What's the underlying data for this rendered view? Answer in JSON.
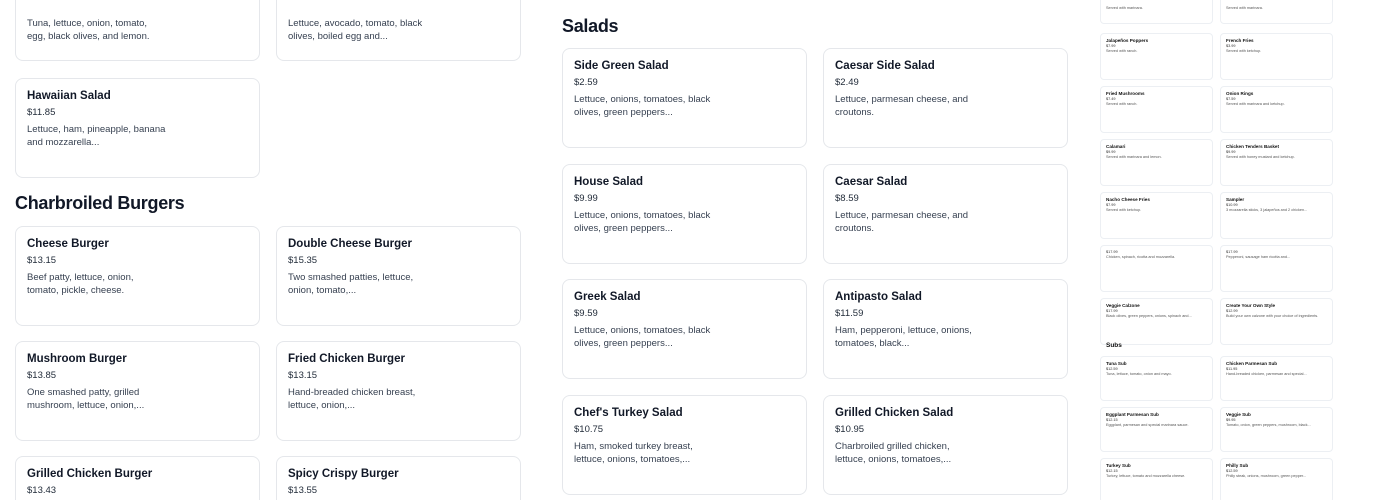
{
  "left_top_cards": [
    {
      "desc": "Tuna, lettuce, onion, tomato, egg, black olives, and lemon."
    },
    {
      "desc": "Lettuce, avocado, tomato, black olives, boiled egg and..."
    }
  ],
  "hawaiian": {
    "name": "Hawaiian Salad",
    "price": "$11.85",
    "desc": "Lettuce, ham, pineapple, banana and mozzarella..."
  },
  "burgers": {
    "title": "Charbroiled Burgers",
    "items": [
      {
        "name": "Cheese Burger",
        "price": "$13.15",
        "desc": "Beef patty, lettuce, onion, tomato, pickle, cheese."
      },
      {
        "name": "Double Cheese Burger",
        "price": "$15.35",
        "desc": "Two smashed patties, lettuce, onion, tomato,..."
      },
      {
        "name": "Mushroom Burger",
        "price": "$13.85",
        "desc": "One smashed patty, grilled mushroom, lettuce, onion,..."
      },
      {
        "name": "Fried Chicken Burger",
        "price": "$13.15",
        "desc": "Hand-breaded chicken breast, lettuce, onion,..."
      },
      {
        "name": "Grilled Chicken Burger",
        "price": "$13.43",
        "desc": ""
      },
      {
        "name": "Spicy Crispy Burger",
        "price": "$13.55",
        "desc": ""
      }
    ]
  },
  "salads": {
    "title": "Salads",
    "items": [
      {
        "name": "Side Green Salad",
        "price": "$2.59",
        "desc": "Lettuce, onions, tomatoes, black olives, green peppers..."
      },
      {
        "name": "Caesar Side Salad",
        "price": "$2.49",
        "desc": "Lettuce, parmesan cheese, and croutons."
      },
      {
        "name": "House Salad",
        "price": "$9.99",
        "desc": "Lettuce, onions, tomatoes, black olives, green peppers..."
      },
      {
        "name": "Caesar Salad",
        "price": "$8.59",
        "desc": "Lettuce, parmesan cheese, and croutons."
      },
      {
        "name": "Greek Salad",
        "price": "$9.59",
        "desc": "Lettuce, onions, tomatoes, black olives, green peppers..."
      },
      {
        "name": "Antipasto Salad",
        "price": "$11.59",
        "desc": "Ham, pepperoni, lettuce, onions, tomatoes, black..."
      },
      {
        "name": "Chef's Turkey Salad",
        "price": "$10.75",
        "desc": "Ham, smoked turkey breast, lettuce, onions, tomatoes,..."
      },
      {
        "name": "Grilled Chicken Salad",
        "price": "$10.95",
        "desc": "Charbroiled grilled chicken, lettuce, onions, tomatoes,..."
      }
    ]
  },
  "mini": {
    "row0": [
      {
        "desc": "Served with marinara."
      },
      {
        "desc": "Served with marinara."
      }
    ],
    "items": [
      {
        "name": "Jalapeños Poppers",
        "price": "$7.99",
        "desc": "Served with ranch."
      },
      {
        "name": "French Fries",
        "price": "$3.99",
        "desc": "Served with ketchup."
      },
      {
        "name": "Fried Mushrooms",
        "price": "$7.49",
        "desc": "Served with ranch."
      },
      {
        "name": "Onion Rings",
        "price": "$7.59",
        "desc": "Served with marinara and ketchup."
      },
      {
        "name": "Calamari",
        "price": "$9.99",
        "desc": "Served with marinara and lemon."
      },
      {
        "name": "Chicken Tenders Basket",
        "price": "$9.99",
        "desc": "Served with honey mustard and ketchup."
      },
      {
        "name": "Nacho Cheese Fries",
        "price": "$7.99",
        "desc": "Served with ketchup."
      },
      {
        "name": "Sampler",
        "price": "$10.99",
        "desc": "3 mozzarella sticks, 3 jalapeños and 2 chicken..."
      },
      {
        "name": "",
        "price": "$17.99",
        "desc": "Chicken, spinach, ricotta and mozzarella."
      },
      {
        "name": "",
        "price": "$17.99",
        "desc": "Pepperoni, sausage ham ricotta and..."
      },
      {
        "name": "Veggie Calzone",
        "price": "$17.99",
        "desc": "Black olives, green peppers, onions, spinach and..."
      },
      {
        "name": "Create Your Own Style",
        "price": "$12.99",
        "desc": "Build your own calzone with your choice of ingredients."
      }
    ],
    "subs_title": "Subs",
    "subs": [
      {
        "name": "Tuna Sub",
        "price": "$12.59",
        "desc": "Tuna, lettuce, tomato, onion and mayo."
      },
      {
        "name": "Chicken Parmesan Sub",
        "price": "$11.95",
        "desc": "Hand-breaded chicken, parmesan and special..."
      },
      {
        "name": "Eggplant Parmesan Sub",
        "price": "$12.15",
        "desc": "Eggplant, parmesan and special marinara sauce."
      },
      {
        "name": "Veggie Sub",
        "price": "$9.95",
        "desc": "Tomato, onion, green peppers, mushroom, black..."
      },
      {
        "name": "Turkey Sub",
        "price": "$12.15",
        "desc": "Turkey, lettuce, tomato and mozzarella cheese."
      },
      {
        "name": "Philly Sub",
        "price": "$12.59",
        "desc": "Philly steak, onions, mushroom, green pepper..."
      }
    ]
  }
}
